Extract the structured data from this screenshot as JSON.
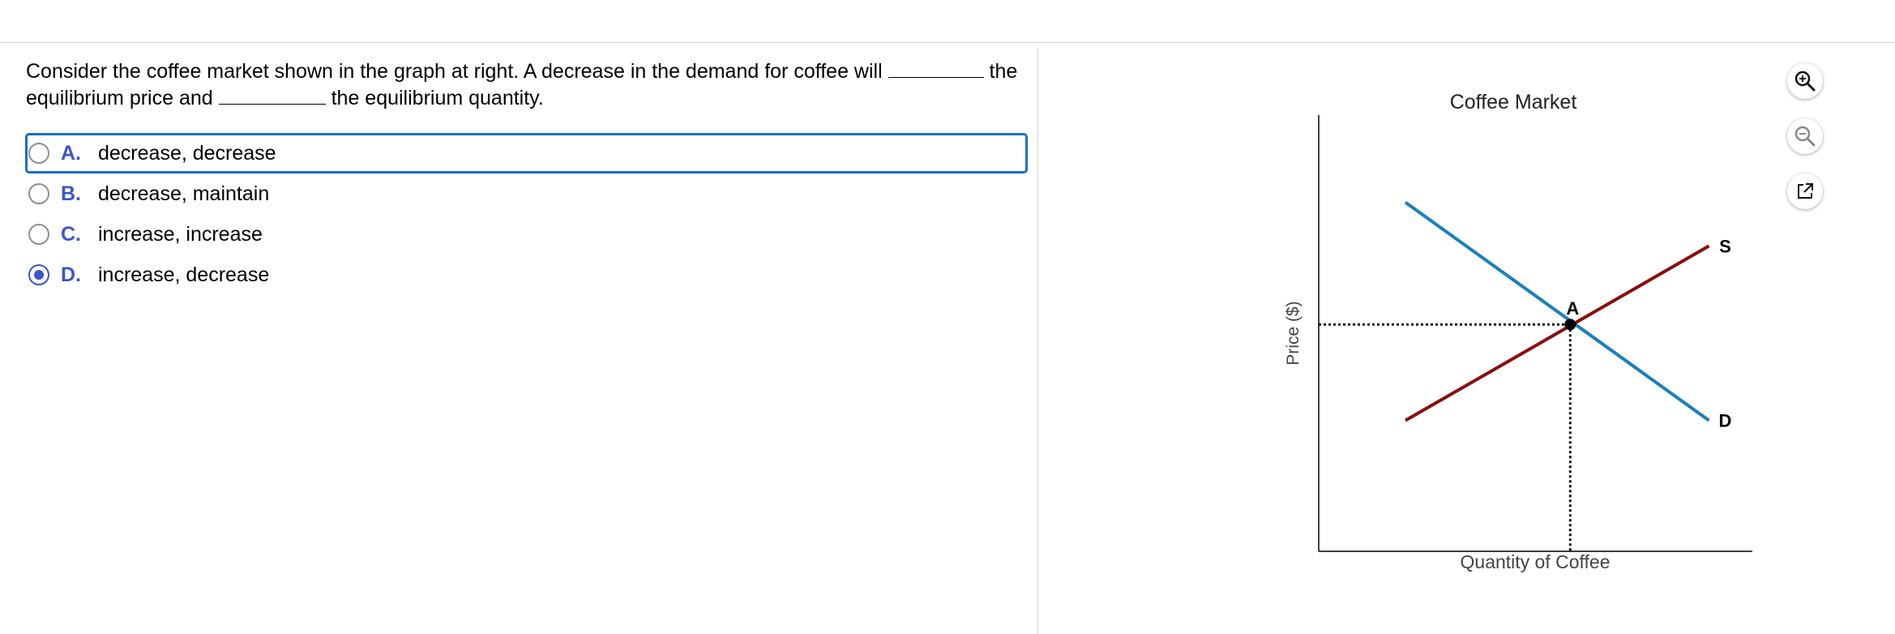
{
  "question": {
    "part1": "Consider the coffee market shown in the graph at right. A decrease in the demand for coffee will",
    "part2": "the equilibrium price and",
    "part3": "the equilibrium quantity."
  },
  "options": [
    {
      "letter": "A.",
      "text": "decrease, decrease",
      "selected": false,
      "focused": true
    },
    {
      "letter": "B.",
      "text": "decrease, maintain",
      "selected": false,
      "focused": false
    },
    {
      "letter": "C.",
      "text": "increase, increase",
      "selected": false,
      "focused": false
    },
    {
      "letter": "D.",
      "text": "increase, decrease",
      "selected": true,
      "focused": false
    }
  ],
  "chart_data": {
    "type": "line",
    "title": "Coffee Market",
    "xlabel": "Quantity of Coffee",
    "ylabel": "Price ($)",
    "series": [
      {
        "name": "D",
        "color": "#1a7fbf",
        "points": [
          [
            0.2,
            0.8
          ],
          [
            0.9,
            0.3
          ]
        ]
      },
      {
        "name": "S",
        "color": "#8b0e0e",
        "points": [
          [
            0.2,
            0.3
          ],
          [
            0.9,
            0.7
          ]
        ]
      }
    ],
    "equilibrium": {
      "label": "A",
      "x": 0.58,
      "y": 0.52
    },
    "xlim": [
      0,
      1
    ],
    "ylim": [
      0,
      1
    ]
  },
  "tools": {
    "icons": [
      "zoom-in-icon",
      "zoom-out-icon",
      "external-link-icon"
    ]
  },
  "colors": {
    "accent": "#3b55c8",
    "focus": "#1a6fc9",
    "demand": "#1a7fbf",
    "supply": "#8b0e0e"
  }
}
